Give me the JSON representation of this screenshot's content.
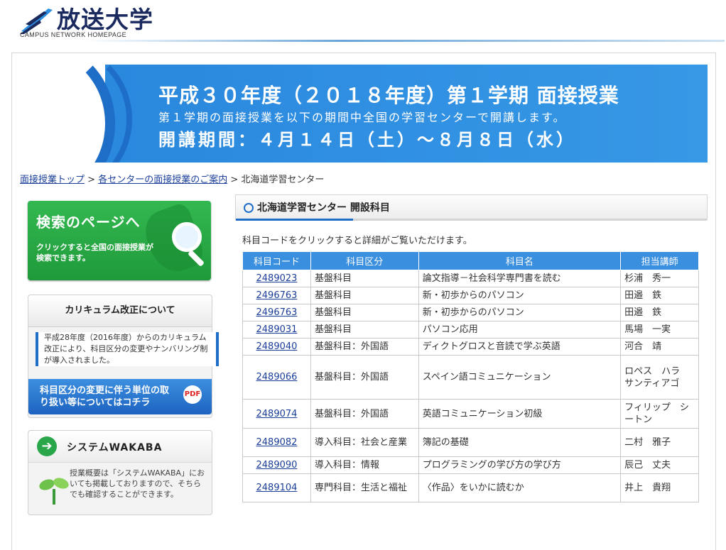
{
  "header": {
    "logo_title": "放送大学",
    "logo_sub": "CAMPUS NETWORK HOMEPAGE"
  },
  "banner": {
    "line1": "平成３０年度（２０１８年度）第１学期 面接授業",
    "line2": "第１学期の面接授業を以下の期間中全国の学習センターで開講します。",
    "line3": "開講期間：４月１４日（土）～８月８日（水）"
  },
  "breadcrumb": {
    "link1": "面接授業トップ",
    "sep1": " > ",
    "link2": "各センターの面接授業のご案内",
    "sep2": " > ",
    "current": "北海道学習センター"
  },
  "sidebar": {
    "search": {
      "title": "検索のページへ",
      "sub": "クリックすると全国の面接授業が検索できます。"
    },
    "curriculum": {
      "title": "カリキュラム改正について",
      "text": "平成28年度（2016年度）からのカリキュラム改正により、科目区分の変更やナンバリング制が導入されました。",
      "button": "科目区分の変更に伴う単位の取り扱い等についてはコチラ",
      "pdf_label": "PDF"
    },
    "wakaba": {
      "title": "システムWAKABA",
      "text": "授業概要は「システムWAKABA」においても掲載しておりますので、そちらでも確認することができます。"
    }
  },
  "content": {
    "heading": "北海道学習センター 開設科目",
    "note": "科目コードをクリックすると詳細がご覧いただけます。",
    "columns": [
      "科目コード",
      "科目区分",
      "科目名",
      "担当講師"
    ],
    "rows": [
      {
        "code": "2489023",
        "category": "基盤科目",
        "name": "論文指導－社会科学専門書を読む",
        "teacher": "杉浦　秀一"
      },
      {
        "code": "2496763",
        "category": "基盤科目",
        "name": "新・初歩からのパソコン",
        "teacher": "田邉　鉄"
      },
      {
        "code": "2496763",
        "category": "基盤科目",
        "name": "新・初歩からのパソコン",
        "teacher": "田邉　鉄"
      },
      {
        "code": "2489031",
        "category": "基盤科目",
        "name": "パソコン応用",
        "teacher": "馬場　一実"
      },
      {
        "code": "2489040",
        "category": "基盤科目：外国語",
        "name": "ディクトグロスと音読で学ぶ英語",
        "teacher": "河合　靖"
      },
      {
        "code": "2489066",
        "category": "基盤科目：外国語",
        "name": "スペイン語コミュニケーション",
        "teacher": "ロペス　ハラ　サンティアゴ"
      },
      {
        "code": "2489074",
        "category": "基盤科目：外国語",
        "name": "英語コミュニケーション初級",
        "teacher": "フィリップ　シートン"
      },
      {
        "code": "2489082",
        "category": "導入科目：社会と産業",
        "name": "簿記の基礎",
        "teacher": "二村　雅子"
      },
      {
        "code": "2489090",
        "category": "導入科目：情報",
        "name": "プログラミングの学び方の学び方",
        "teacher": "辰己　丈夫"
      },
      {
        "code": "2489104",
        "category": "専門科目：生活と福祉",
        "name": "〈作品〉をいかに読むか",
        "teacher": "井上　貴翔"
      }
    ]
  }
}
